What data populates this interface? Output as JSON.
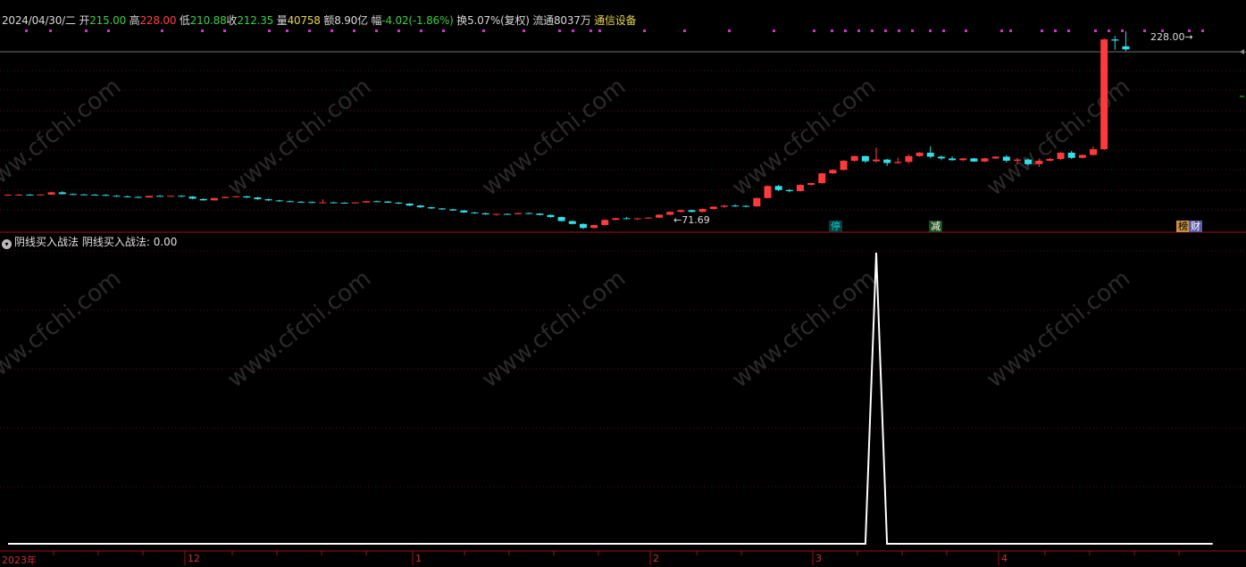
{
  "header": {
    "date": "2024/04/30/二",
    "open_label": "开",
    "open": "215.00",
    "high_label": "高",
    "high": "228.00",
    "low_label": "低",
    "low": "210.88",
    "close_label": "收",
    "close": "212.35",
    "volume_label": "量",
    "volume": "40758",
    "amount_label": "额",
    "amount": "8.90亿",
    "change_label": "幅",
    "change": "-4.02(-1.86%)",
    "turnover_label": "换",
    "turnover": "5.07%(复权)",
    "float_label": "流通",
    "float": "8037万",
    "industry": "通信设备"
  },
  "price_marks": {
    "high": "228.00",
    "low": "71.69"
  },
  "tags": {
    "ting": "停",
    "jian": "减",
    "bang": "榜",
    "cai": "财"
  },
  "indicator": {
    "name": "阴线买入战法",
    "series_label": "阴线买入战法:",
    "value": "0.00"
  },
  "x_axis": {
    "labels": [
      "2023年",
      "12",
      "1",
      "2",
      "3",
      "4"
    ]
  },
  "colors": {
    "up": "#ff3a3a",
    "down": "#33e0e8",
    "flat": "#dddddd",
    "axis": "#a01010",
    "grid": "#5a1010"
  },
  "watermark": "www.cfchi.com",
  "chart_data": [
    {
      "type": "candlestick",
      "ylim": [
        65,
        232
      ],
      "candles": [
        [
          85.8,
          86.4,
          85.2,
          85.9
        ],
        [
          85.9,
          86.6,
          85.4,
          86.0
        ],
        [
          86.0,
          86.5,
          85.6,
          85.9
        ],
        [
          85.9,
          86.3,
          85.5,
          86.1
        ],
        [
          86.0,
          88.5,
          85.8,
          88.0
        ],
        [
          88.0,
          89.0,
          86.0,
          86.5
        ],
        [
          86.5,
          87.0,
          85.8,
          86.2
        ],
        [
          86.2,
          86.6,
          85.8,
          86.0
        ],
        [
          86.0,
          86.5,
          85.5,
          85.8
        ],
        [
          85.8,
          86.3,
          84.8,
          85.0
        ],
        [
          85.0,
          85.5,
          84.2,
          84.5
        ],
        [
          84.5,
          85.0,
          83.8,
          84.0
        ],
        [
          84.0,
          84.5,
          83.2,
          83.5
        ],
        [
          83.5,
          85.0,
          83.4,
          84.9
        ],
        [
          84.9,
          85.5,
          84.0,
          84.3
        ],
        [
          84.3,
          85.2,
          84.0,
          85.0
        ],
        [
          85.0,
          85.4,
          84.0,
          84.3
        ],
        [
          84.3,
          84.7,
          82.0,
          82.5
        ],
        [
          82.2,
          82.8,
          80.8,
          81.0
        ],
        [
          81.0,
          83.2,
          80.9,
          83.0
        ],
        [
          83.0,
          84.2,
          82.8,
          84.0
        ],
        [
          84.0,
          84.8,
          83.5,
          84.5
        ],
        [
          84.5,
          85.0,
          83.0,
          83.5
        ],
        [
          83.5,
          84.0,
          81.5,
          82.0
        ],
        [
          82.0,
          82.5,
          80.5,
          81.0
        ],
        [
          81.0,
          81.5,
          79.8,
          80.3
        ],
        [
          80.3,
          80.8,
          79.5,
          79.8
        ],
        [
          79.8,
          80.3,
          79.2,
          79.6
        ],
        [
          79.6,
          80.0,
          78.5,
          79.0
        ],
        [
          79.0,
          82.0,
          78.8,
          79.3
        ],
        [
          79.3,
          79.8,
          78.6,
          79.0
        ],
        [
          79.0,
          79.4,
          78.5,
          78.8
        ],
        [
          78.8,
          79.5,
          78.2,
          79.2
        ],
        [
          79.2,
          80.5,
          79.0,
          80.3
        ],
        [
          80.3,
          80.8,
          79.8,
          80.0
        ],
        [
          80.0,
          80.4,
          78.8,
          79.0
        ],
        [
          79.0,
          79.5,
          77.8,
          78.2
        ],
        [
          78.2,
          78.6,
          76.0,
          76.5
        ],
        [
          76.5,
          77.0,
          74.5,
          75.0
        ],
        [
          75.0,
          75.4,
          73.5,
          74.0
        ],
        [
          74.0,
          74.4,
          72.8,
          73.2
        ],
        [
          73.2,
          73.7,
          71.8,
          72.2
        ],
        [
          72.2,
          72.6,
          70.0,
          70.5
        ],
        [
          70.5,
          70.9,
          69.2,
          69.8
        ],
        [
          69.8,
          70.4,
          68.6,
          68.8
        ],
        [
          68.8,
          69.3,
          67.7,
          69.2
        ],
        [
          69.2,
          69.7,
          68.5,
          69.0
        ],
        [
          69.0,
          70.2,
          68.8,
          70.0
        ],
        [
          70.0,
          70.4,
          69.0,
          69.5
        ],
        [
          69.5,
          69.8,
          68.0,
          68.3
        ],
        [
          68.3,
          68.7,
          66.0,
          66.5
        ],
        [
          66.5,
          66.9,
          62.5,
          63.0
        ],
        [
          63.0,
          63.5,
          60.0,
          60.5
        ],
        [
          60.5,
          61.0,
          56.0,
          57.0
        ],
        [
          57.0,
          59.8,
          56.5,
          59.5
        ],
        [
          59.5,
          64.5,
          59.0,
          64.0
        ],
        [
          64.0,
          65.8,
          63.8,
          65.5
        ],
        [
          65.5,
          66.5,
          64.5,
          65.0
        ],
        [
          65.0,
          65.6,
          64.0,
          65.4
        ],
        [
          65.4,
          66.2,
          64.8,
          66.0
        ],
        [
          66.0,
          69.0,
          65.8,
          68.5
        ],
        [
          68.5,
          71.5,
          68.0,
          71.0
        ],
        [
          71.0,
          73.0,
          70.5,
          72.5
        ],
        [
          72.5,
          73.0,
          70.5,
          71.0
        ],
        [
          71.0,
          74.0,
          70.5,
          73.5
        ],
        [
          73.5,
          76.0,
          73.0,
          75.5
        ],
        [
          75.5,
          77.0,
          74.5,
          76.5
        ],
        [
          76.5,
          77.5,
          75.5,
          76.2
        ],
        [
          76.2,
          76.8,
          75.0,
          75.8
        ],
        [
          75.8,
          83.5,
          75.5,
          83.0
        ],
        [
          83.0,
          94.0,
          83.0,
          93.5
        ],
        [
          93.5,
          94.5,
          89.0,
          90.0
        ],
        [
          90.0,
          91.0,
          88.0,
          89.0
        ],
        [
          89.0,
          95.0,
          88.8,
          94.5
        ],
        [
          94.5,
          96.5,
          94.0,
          96.0
        ],
        [
          96.0,
          105.0,
          95.5,
          104.5
        ],
        [
          104.5,
          108.0,
          104.0,
          107.5
        ],
        [
          107.5,
          116.0,
          107.0,
          115.5
        ],
        [
          115.5,
          120.0,
          114.5,
          119.5
        ],
        [
          119.5,
          120.0,
          113.5,
          115.0
        ],
        [
          115.0,
          127.0,
          114.0,
          116.5
        ],
        [
          116.5,
          117.0,
          111.0,
          113.5
        ],
        [
          113.5,
          118.0,
          113.0,
          114.5
        ],
        [
          114.5,
          121.0,
          113.0,
          119.5
        ],
        [
          119.5,
          123.0,
          119.0,
          122.5
        ],
        [
          122.5,
          128.0,
          117.5,
          119.0
        ],
        [
          119.0,
          120.0,
          116.0,
          117.5
        ],
        [
          117.5,
          119.5,
          115.5,
          116.0
        ],
        [
          116.0,
          118.0,
          115.0,
          117.5
        ],
        [
          117.5,
          118.0,
          114.5,
          114.8
        ],
        [
          114.8,
          118.0,
          114.3,
          117.5
        ],
        [
          117.5,
          119.5,
          117.0,
          119.0
        ],
        [
          119.0,
          120.5,
          114.0,
          115.5
        ],
        [
          115.5,
          118.0,
          112.0,
          116.5
        ],
        [
          116.5,
          117.5,
          111.5,
          112.5
        ],
        [
          112.5,
          116.5,
          110.0,
          115.5
        ],
        [
          115.5,
          118.0,
          115.0,
          117.0
        ],
        [
          117.0,
          123.0,
          116.0,
          122.5
        ],
        [
          122.5,
          124.0,
          117.0,
          118.0
        ],
        [
          118.0,
          121.0,
          117.5,
          120.5
        ],
        [
          120.5,
          128.0,
          120.0,
          125.5
        ],
        [
          125.5,
          222.0,
          125.0,
          221.0
        ],
        [
          221.0,
          224.0,
          212.0,
          220.0
        ],
        [
          215.0,
          228.0,
          210.88,
          212.35
        ]
      ]
    },
    {
      "type": "line",
      "series": [
        {
          "name": "阴线买入战法",
          "points": [
            [
              0,
              0
            ],
            [
              79,
              0
            ],
            [
              80,
              1
            ],
            [
              81,
              0
            ],
            [
              111,
              0
            ]
          ]
        }
      ]
    }
  ]
}
